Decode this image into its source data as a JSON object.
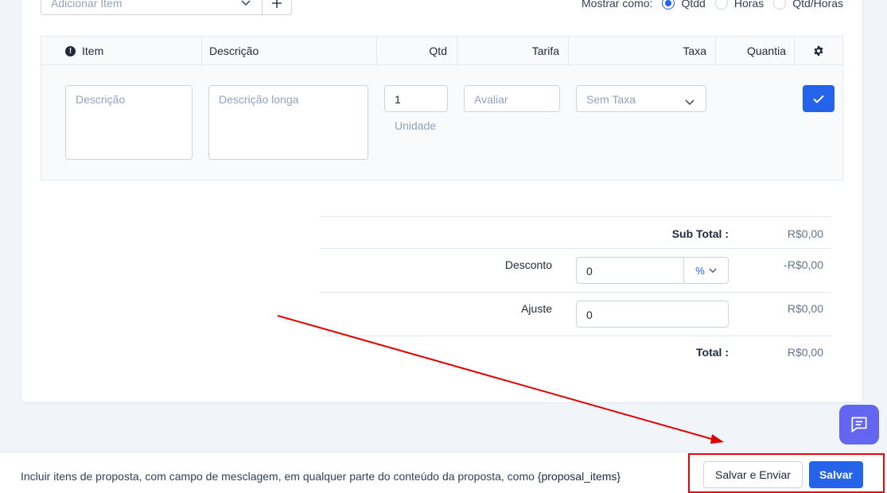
{
  "top": {
    "add_item_placeholder": "Adicionar Item",
    "show_as_label": "Mostrar como:",
    "show_as_options": [
      "Qtdd",
      "Horas",
      "Qtd/Horas"
    ],
    "show_as_selected": "Qtdd"
  },
  "table": {
    "headers": [
      "Item",
      "Descrição",
      "Qtd",
      "Tarifa",
      "Taxa",
      "Quantia"
    ],
    "row": {
      "description_placeholder": "Descrição",
      "long_description_placeholder": "Descrição longa",
      "qty_value": "1",
      "unit_placeholder": "Unidade",
      "rate_placeholder": "Avaliar",
      "tax_value": "Sem Taxa"
    }
  },
  "totals": {
    "subtotal_label": "Sub Total :",
    "subtotal_value": "R$0,00",
    "discount_label": "Desconto",
    "discount_input": "0",
    "discount_type": "%",
    "discount_value": "-R$0,00",
    "adjust_label": "Ajuste",
    "adjust_input": "0",
    "adjust_value": "R$0,00",
    "total_label": "Total :",
    "total_value": "R$0,00"
  },
  "footer": {
    "note_text": "Incluir itens de proposta, com campo de mesclagem, em qualquer parte do conteúdo da proposta, como",
    "note_tag": "{proposal_items}",
    "save_send_label": "Salvar e Enviar",
    "save_label": "Salvar"
  },
  "colors": {
    "primary": "#2563eb",
    "chat_button": "#6366f1",
    "annotation": "#e00000"
  },
  "icons": [
    "chevron-down-icon",
    "plus-icon",
    "alert-circle-icon",
    "gear-icon",
    "check-icon",
    "chat-icon"
  ]
}
